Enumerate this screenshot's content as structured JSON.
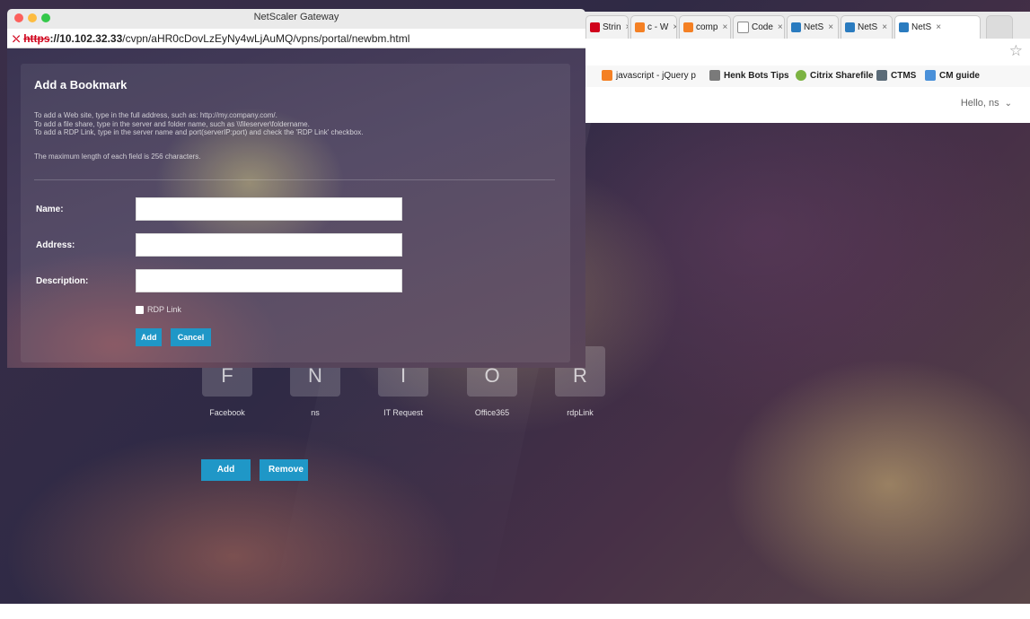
{
  "popup": {
    "window_title": "NetScaler Gateway",
    "url_scheme": "https",
    "url_host": "://10.102.32.33",
    "url_path": "/cvpn/aHR0cDovLzEyNy4wLjAuMQ/vpns/portal/newbm.html"
  },
  "dialog": {
    "title": "Add a Bookmark",
    "help_lines": [
      "To add a Web site, type in the full address, such as: http://my.company.com/.",
      "To add a file share, type in the server and folder name, such as \\\\fileserver\\foldername.",
      "To add a RDP Link, type in the server name and port(serverIP:port) and check the 'RDP Link' checkbox."
    ],
    "max_length_note": "The maximum length of each field is 256 characters.",
    "fields": {
      "name_label": "Name:",
      "name_value": "",
      "address_label": "Address:",
      "address_value": "",
      "description_label": "Description:",
      "description_value": ""
    },
    "rdp_label": "RDP Link",
    "rdp_checked": false,
    "add_label": "Add",
    "cancel_label": "Cancel"
  },
  "browser": {
    "tabs": [
      {
        "label": "Strin",
        "icon": "red-c-icon",
        "color": "#d0021b"
      },
      {
        "label": "c - W",
        "icon": "stackoverflow-icon",
        "color": "#f48024"
      },
      {
        "label": "comp",
        "icon": "stackoverflow-icon",
        "color": "#f48024"
      },
      {
        "label": "Code",
        "icon": "document-icon",
        "color": "#8a8a8a"
      },
      {
        "label": "NetS",
        "icon": "netscaler-icon",
        "color": "#2a7bbf"
      },
      {
        "label": "NetS",
        "icon": "netscaler-icon",
        "color": "#2a7bbf"
      },
      {
        "label": "NetS",
        "icon": "netscaler-icon",
        "color": "#2a7bbf"
      }
    ],
    "bookmarks": [
      {
        "label": "javascript - jQuery p",
        "color": "#f48024"
      },
      {
        "label": "Henk Bots Tips",
        "color": "#7a7a7a"
      },
      {
        "label": "Citrix Sharefile",
        "color": "#7cb342"
      },
      {
        "label": "CTMS",
        "color": "#5b6b78"
      },
      {
        "label": "CM guide",
        "color": "#4a90d9"
      }
    ],
    "greeting": "Hello, ns"
  },
  "portal": {
    "tiles": [
      {
        "letter": "F",
        "label": "Facebook"
      },
      {
        "letter": "N",
        "label": "ns"
      },
      {
        "letter": "I",
        "label": "IT Request"
      },
      {
        "letter": "O",
        "label": "Office365"
      },
      {
        "letter": "R",
        "label": "rdpLink"
      }
    ],
    "add_label": "Add",
    "remove_label": "Remove"
  },
  "colors": {
    "accent": "#1f97c7",
    "traffic_red": "#fc605c",
    "traffic_yellow": "#fdbc40",
    "traffic_green": "#34c84a"
  }
}
